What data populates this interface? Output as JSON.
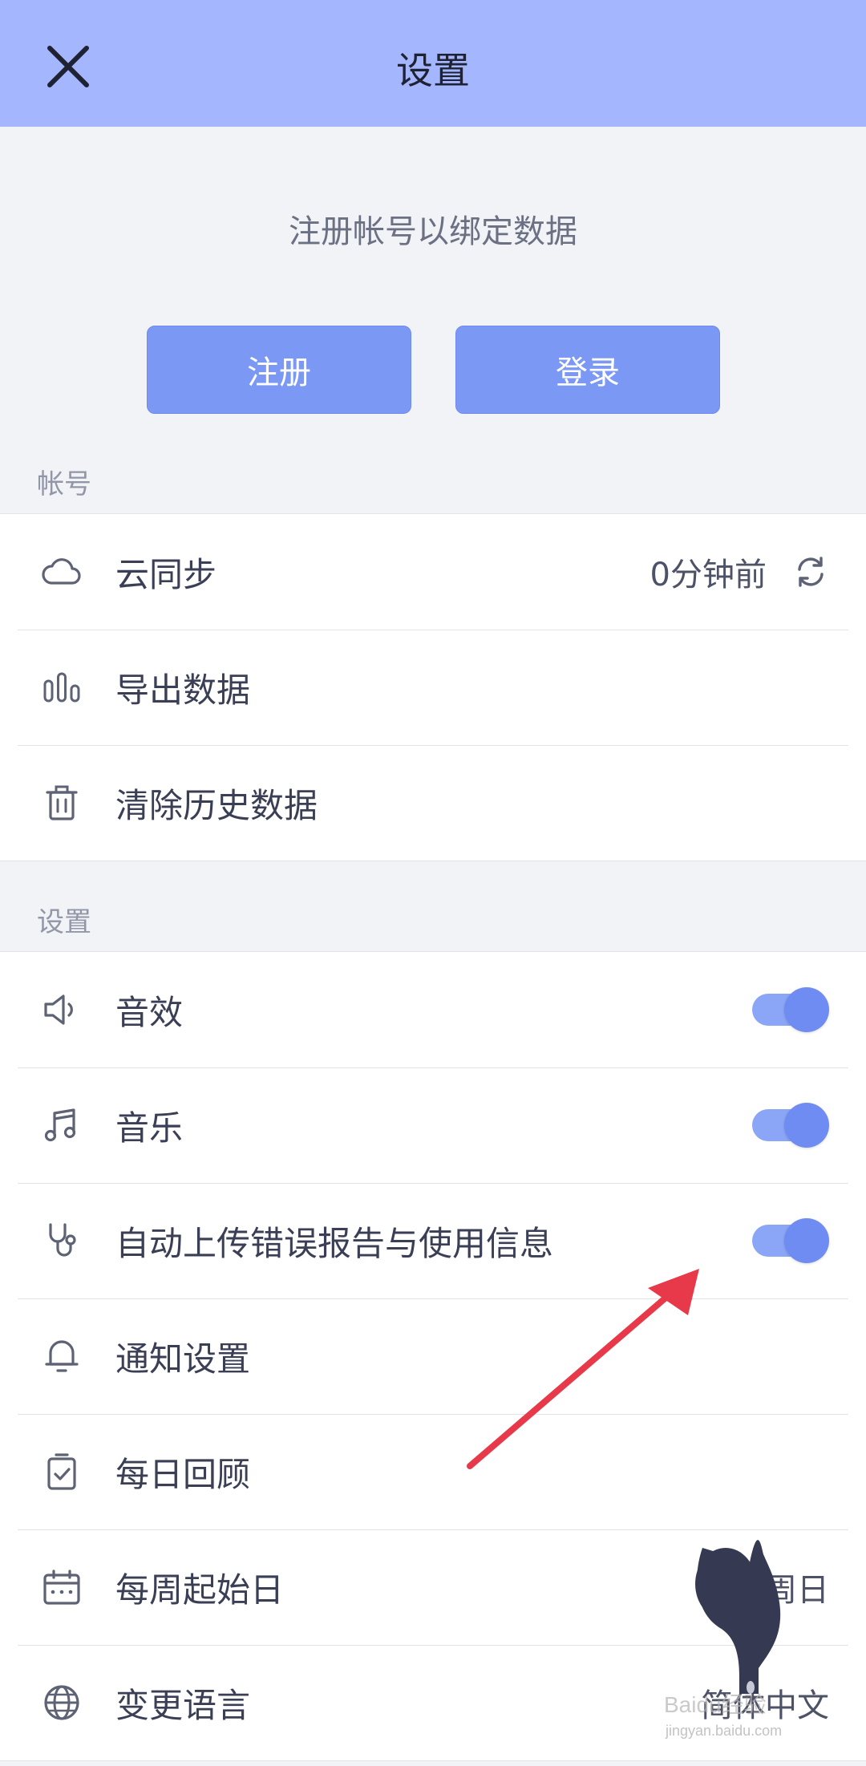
{
  "header": {
    "title": "设置"
  },
  "account_prompt": "注册帐号以绑定数据",
  "buttons": {
    "register": "注册",
    "login": "登录"
  },
  "sections": {
    "account": {
      "label": "帐号",
      "rows": {
        "cloud_sync": {
          "label": "云同步",
          "value": "0分钟前"
        },
        "export": {
          "label": "导出数据"
        },
        "clear": {
          "label": "清除历史数据"
        }
      }
    },
    "settings": {
      "label": "设置",
      "rows": {
        "sound_effects": {
          "label": "音效",
          "enabled": true
        },
        "music": {
          "label": "音乐",
          "enabled": true
        },
        "auto_upload": {
          "label": "自动上传错误报告与使用信息",
          "enabled": true
        },
        "notifications": {
          "label": "通知设置"
        },
        "daily_review": {
          "label": "每日回顾"
        },
        "week_start": {
          "label": "每周起始日",
          "value": "周日"
        },
        "language": {
          "label": "变更语言",
          "value": "简体中文"
        }
      }
    }
  },
  "colors": {
    "header_bg": "#a4b6fd",
    "button_bg": "#7b98f5",
    "toggle_knob": "#6e8cf1",
    "toggle_track": "#8ba6f7",
    "arrow": "#e8394a",
    "hand": "#353a52"
  },
  "watermark": {
    "main": "Baidu经验",
    "sub": "jingyan.baidu.com"
  }
}
